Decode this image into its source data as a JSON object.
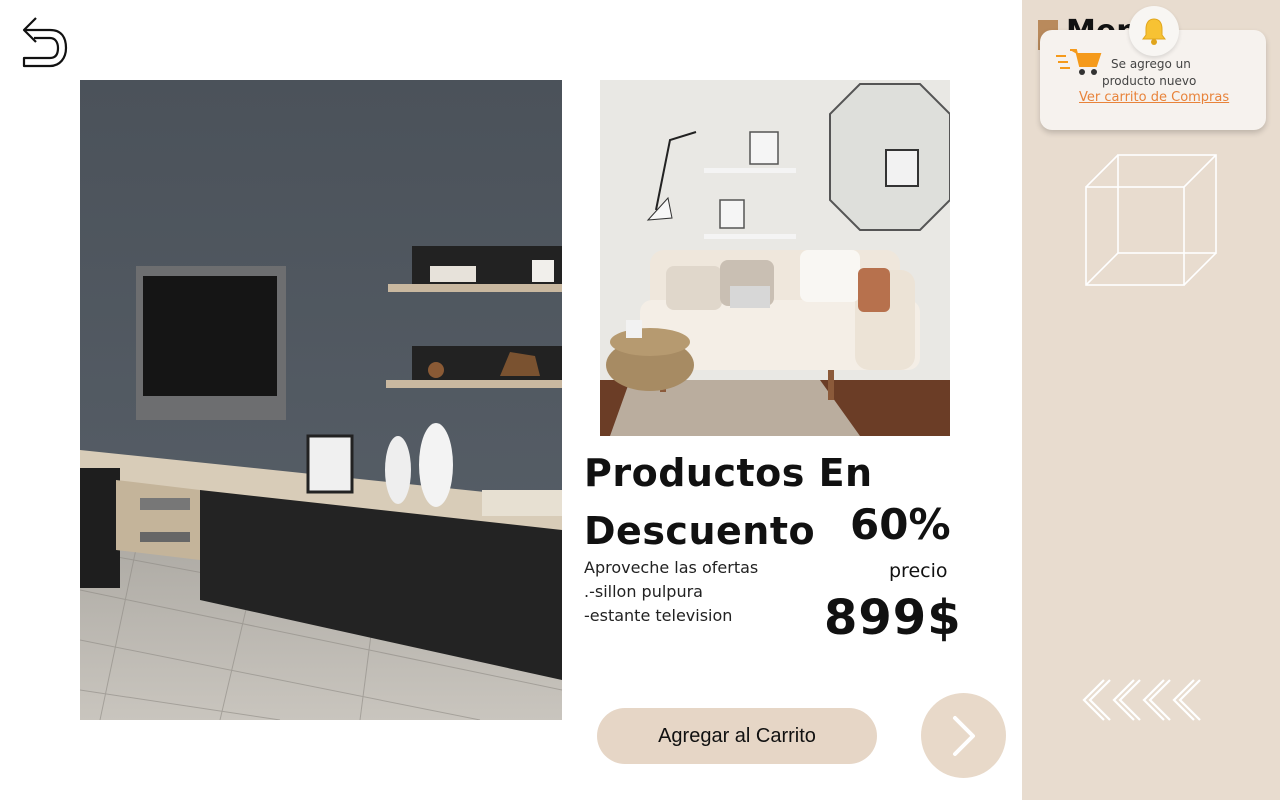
{
  "promo": {
    "title_line1": "Productos En",
    "title_line2": "Descuento",
    "discount": "60%",
    "description": [
      "Aproveche las ofertas",
      ".-sillon pulpura",
      "-estante television"
    ],
    "price_label": "precio",
    "price": "899$"
  },
  "actions": {
    "add_to_cart": "Agregar al Carrito"
  },
  "notification": {
    "line1": "Se agrego un",
    "line2": "producto nuevo",
    "link": "Ver carrito de Compras"
  },
  "panel": {
    "menu_text": "Menú"
  },
  "colors": {
    "panel_bg": "#e8dccf",
    "button_bg": "#e6d6c6",
    "link": "#e8833a",
    "cart_orange": "#f59a1b",
    "bell_yellow": "#f7c233"
  },
  "icons": {
    "back": "undo-arrow-icon",
    "next": "chevron-right-icon",
    "bell": "bell-icon",
    "cart": "shopping-cart-icon",
    "decor_cube": "cube-outline-icon",
    "decor_chevrons": "chevrons-left-icon"
  }
}
